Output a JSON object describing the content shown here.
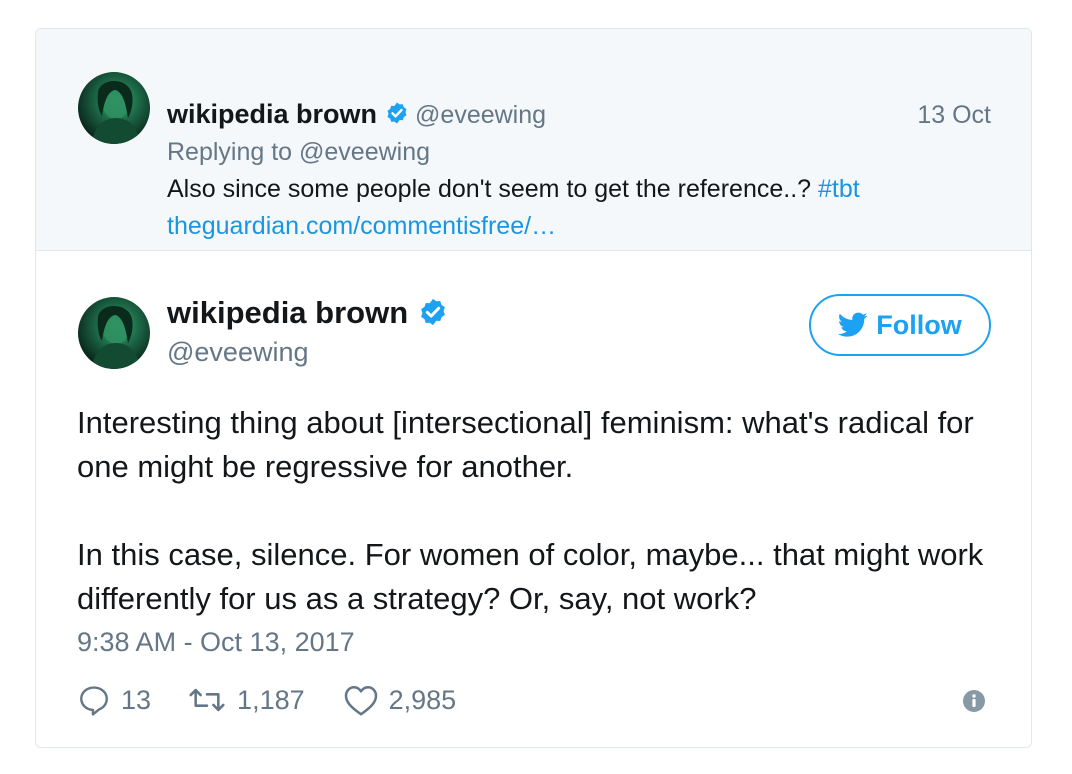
{
  "parent_tweet": {
    "author_name": "wikipedia brown",
    "handle": "@eveewing",
    "date": "13 Oct",
    "replying_to": "Replying to @eveewing",
    "text": "Also since some people don't seem to get the reference..? ",
    "hashtag": "#tbt",
    "link": "theguardian.com/commentisfree/…"
  },
  "main_tweet": {
    "author_name": "wikipedia brown",
    "handle": "@eveewing",
    "follow_label": "Follow",
    "paragraphs": [
      "Interesting thing about [intersectional] feminism: what's radical for one might be regressive for another.",
      "In this case, silence. For women of color, maybe... that might work differently for us as a strategy? Or, say, not work?"
    ],
    "timestamp": "9:38 AM - Oct 13, 2017",
    "actions": {
      "replies": "13",
      "retweets": "1,187",
      "likes": "2,985"
    }
  },
  "icons": {
    "verified": "verified-badge-icon",
    "follow": "twitter-bird-icon",
    "reply": "reply-icon",
    "retweet": "retweet-icon",
    "like": "heart-icon",
    "info": "info-icon"
  },
  "colors": {
    "brand_blue": "#1da1f2",
    "link_blue": "#1b95e0",
    "muted_text": "#657786",
    "parent_background": "#f5f8fa"
  }
}
